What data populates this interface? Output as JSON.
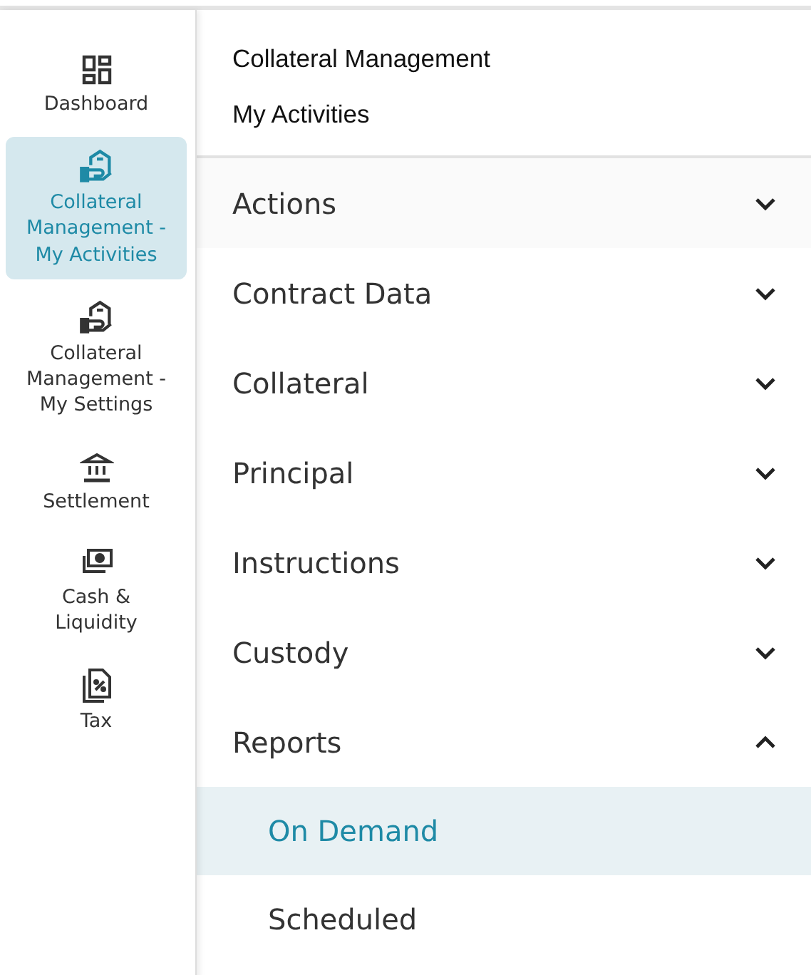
{
  "sidebar": {
    "items": [
      {
        "label": "Dashboard",
        "kind": "dashboard",
        "selected": false
      },
      {
        "label": "Collateral Management - My Activities",
        "kind": "collateral",
        "selected": true
      },
      {
        "label": "Collateral Management - My Settings",
        "kind": "collateral",
        "selected": false
      },
      {
        "label": "Settlement",
        "kind": "bank",
        "selected": false
      },
      {
        "label": "Cash & Liquidity",
        "kind": "cash",
        "selected": false
      },
      {
        "label": "Tax",
        "kind": "tax",
        "selected": false
      }
    ]
  },
  "header": {
    "title": "Collateral Management",
    "subtitle": "My Activities"
  },
  "sections": [
    {
      "label": "Actions",
      "expanded": false
    },
    {
      "label": "Contract Data",
      "expanded": false
    },
    {
      "label": "Collateral",
      "expanded": false
    },
    {
      "label": "Principal",
      "expanded": false
    },
    {
      "label": "Instructions",
      "expanded": false
    },
    {
      "label": "Custody",
      "expanded": false
    },
    {
      "label": "Reports",
      "expanded": true,
      "children": [
        {
          "label": "On Demand",
          "selected": true
        },
        {
          "label": "Scheduled",
          "selected": false
        }
      ]
    }
  ]
}
